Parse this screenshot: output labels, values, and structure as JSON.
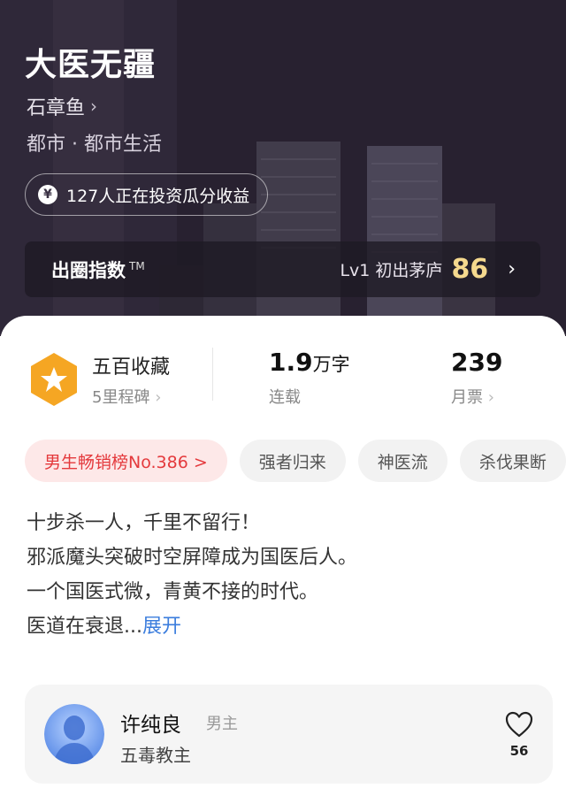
{
  "book": {
    "title": "大医无疆",
    "author": "石章鱼",
    "genre": "都市 · 都市生活",
    "invest_text": "127人正在投资瓜分收益",
    "invest_icon": "yen-coin-icon"
  },
  "index_bar": {
    "label": "出圈指数",
    "tm": "TM",
    "level_text": "Lv1 初出茅庐",
    "score": "86"
  },
  "stats": {
    "collect_title": "五百收藏",
    "collect_sub": "5里程碑",
    "words_value": "1.9",
    "words_unit": "万字",
    "words_status": "连载",
    "tickets_value": "239",
    "tickets_label": "月票"
  },
  "tags": [
    {
      "label": "男生畅销榜No.386 >"
    },
    {
      "label": "强者归来"
    },
    {
      "label": "神医流"
    },
    {
      "label": "杀伐果断"
    }
  ],
  "synopsis": {
    "lines": [
      "十步杀一人，千里不留行！",
      "邪派魔头突破时空屏障成为国医后人。",
      "一个国医式微，青黄不接的时代。",
      "医道在衰退..."
    ],
    "expand_label": "展开"
  },
  "character": {
    "name": "许纯良",
    "role": "男主",
    "desc": "五毒教主",
    "likes": "56"
  },
  "colors": {
    "score": "#f5d98e",
    "rank_tag_text": "#e4393c",
    "rank_tag_bg": "#fde8e8",
    "expand_link": "#3b7ddd",
    "badge": "#f5a623"
  }
}
